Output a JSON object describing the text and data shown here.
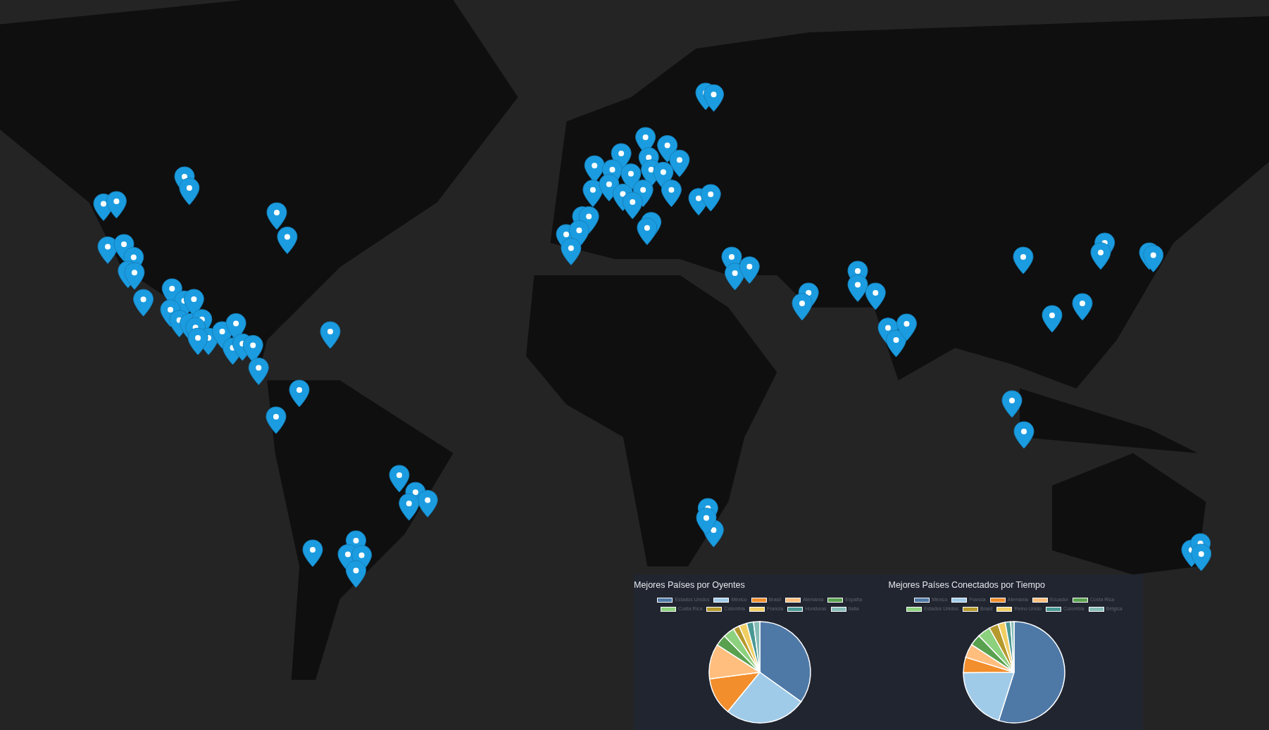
{
  "charts": [
    {
      "chart_data": {
        "type": "pie",
        "legend": "top",
        "title": "Mejores Países por Oyentes",
        "categories": [
          "Estados Unidos",
          "México",
          "Brasil",
          "Alemania",
          "España",
          "Costa Rica",
          "Colombia",
          "Francia",
          "Honduras",
          "Italia"
        ],
        "values": [
          34.9,
          26,
          12,
          11.2,
          3.6,
          3.6,
          2,
          2.5,
          2.2,
          2
        ]
      }
    },
    {
      "chart_data": {
        "type": "pie",
        "legend": "top",
        "title": "Mejores Países Conectados por Tiempo",
        "categories": [
          "México",
          "Francia",
          "Alemania",
          "Ecuador",
          "Costa Rica",
          "Estados Unidos",
          "Brasil",
          "Reino Unido",
          "Colombia",
          "Bélgica"
        ],
        "values": [
          54.9,
          20,
          4.9,
          4.4,
          3.6,
          4.1,
          3,
          2.3,
          1.7,
          1.1
        ]
      }
    }
  ]
}
